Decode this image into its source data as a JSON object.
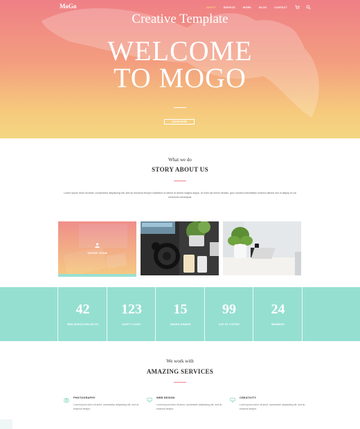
{
  "header": {
    "logo": "MoGo",
    "nav": [
      {
        "label": "ABOUT",
        "active": true
      },
      {
        "label": "SERVICE",
        "active": false
      },
      {
        "label": "WORK",
        "active": false
      },
      {
        "label": "BLOG",
        "active": false
      },
      {
        "label": "CONTACT",
        "active": false
      }
    ],
    "icons": [
      "cart-icon",
      "search-icon"
    ]
  },
  "hero": {
    "subtitle": "Creative Template",
    "title_line1": "WELCOME",
    "title_line2": "TO MOGO",
    "button": "LEARN MORE"
  },
  "about": {
    "kicker": "What we do",
    "title": "STORY ABOUT US",
    "paragraph": "Lorem ipsum dolor sit amet, consectetur adipisicing elit, sed do eiusmod tempor incididunt ut labore et dolore magna aliqua. Ut enim ad minim veniam, quis nostrud exercitation ullamco laboris nisi ut aliquip ex ea commodo consequat."
  },
  "photos": [
    {
      "label": "SUPER TEAM"
    },
    {
      "label": ""
    },
    {
      "label": ""
    }
  ],
  "stats": [
    {
      "value": "42",
      "label": "WEB DESIGN PROJECTS"
    },
    {
      "value": "123",
      "label": "HAPPY CLIENT"
    },
    {
      "value": "15",
      "label": "AWARD WINNER"
    },
    {
      "value": "99",
      "label": "CUP OF COFFEE"
    },
    {
      "value": "24",
      "label": "MEMBERS"
    }
  ],
  "services": {
    "kicker": "We work with",
    "title": "AMAZING SERVICES",
    "items": [
      {
        "title": "PHOTOGRAPHY",
        "desc": "Lorem ipsum dolor sit amet, consectetur adipisicing elit, sed do eiusmod tempor.",
        "icon": "camera-icon"
      },
      {
        "title": "WEB DESIGN",
        "desc": "Lorem ipsum dolor sit amet, consectetur adipisicing elit, sed do eiusmod tempor.",
        "icon": "monitor-icon"
      },
      {
        "title": "CREATIVITY",
        "desc": "Lorem ipsum dolor sit amet, consectetur adipisicing elit, sed do eiusmod tempor.",
        "icon": "monitor-icon"
      }
    ]
  },
  "colors": {
    "accent": "#ef7f86",
    "teal": "#95dfd1",
    "hero_top": "#ef7f86",
    "hero_bottom": "#f4d782"
  }
}
